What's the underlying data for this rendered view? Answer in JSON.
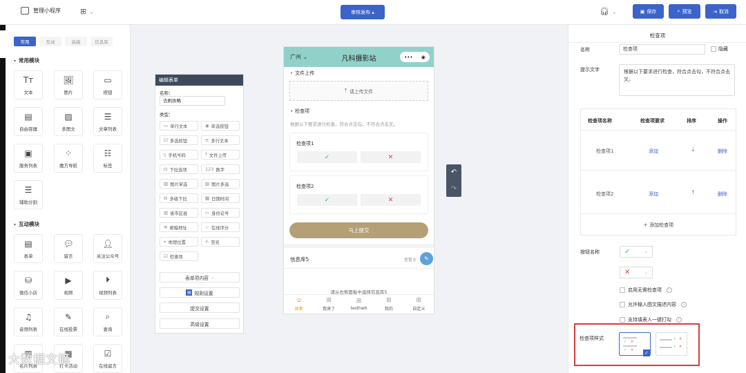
{
  "topbar": {
    "app_name": "管理小程序",
    "publish_label": "审核发布 ▴",
    "save_label": "保存",
    "preview_label": "预览",
    "cancel_label": "取消"
  },
  "left": {
    "tabs": [
      "常用",
      "互动",
      "高级",
      "信息库"
    ],
    "section_common": "常用模块",
    "section_interact": "互动模块",
    "common_items": [
      {
        "label": "文本",
        "icon": "text-icon"
      },
      {
        "label": "图片",
        "icon": "image-icon"
      },
      {
        "label": "按钮",
        "icon": "button-icon"
      },
      {
        "label": "自由容器",
        "icon": "container-icon"
      },
      {
        "label": "多图文",
        "icon": "multi-image-text-icon"
      },
      {
        "label": "文章列表",
        "icon": "article-list-icon"
      },
      {
        "label": "服务列表",
        "icon": "service-list-icon"
      },
      {
        "label": "魔方导航",
        "icon": "cube-nav-icon"
      },
      {
        "label": "标签",
        "icon": "tag-icon"
      },
      {
        "label": "辅助分割",
        "icon": "divider-icon"
      }
    ],
    "interact_items": [
      {
        "label": "表单",
        "icon": "form-icon"
      },
      {
        "label": "留言",
        "icon": "message-icon"
      },
      {
        "label": "关注公众号",
        "icon": "follow-icon"
      },
      {
        "label": "微信小店",
        "icon": "shop-icon"
      },
      {
        "label": "视频",
        "icon": "video-icon"
      },
      {
        "label": "视频列表",
        "icon": "video-list-icon"
      },
      {
        "label": "音频列表",
        "icon": "audio-list-icon"
      },
      {
        "label": "在线投票",
        "icon": "vote-icon"
      },
      {
        "label": "查询",
        "icon": "query-icon"
      },
      {
        "label": "名片列表",
        "icon": "card-list-icon"
      },
      {
        "label": "打卡活动",
        "icon": "checkin-icon"
      },
      {
        "label": "在线留言",
        "icon": "online-message-icon"
      }
    ],
    "watermark": "大数据文摘"
  },
  "form_editor": {
    "header": "编辑表单",
    "name_label": "名称：",
    "name_value": "去刷攻略",
    "type_label": "类型：",
    "types": [
      "单行文本",
      "单选按钮",
      "多选按钮",
      "多行文本",
      "手机号码",
      "文件上传",
      "下拉选项",
      "数字",
      "图片单选",
      "图片多选",
      "多级下拉",
      "日期时间",
      "省市区县",
      "身份证号",
      "邮箱地址",
      "在线评分",
      "地理位置",
      "签名",
      "检查项"
    ],
    "btn_content": "表单项内容",
    "btn_rules": "规则设置",
    "btn_submit": "提交设置",
    "btn_advanced": "高级设置"
  },
  "phone": {
    "city": "广州",
    "title": "凡科摄影站",
    "upload_section": "文件上传",
    "upload_button": "请上传文件",
    "check_section": "检查项",
    "check_desc": "根据以下要求进行检查，符合点击勾，不符合点击叉。",
    "check_items": [
      "检查项1",
      "检查项2"
    ],
    "submit": "马上提交",
    "info_title": "信息库5",
    "info_more": "查看全",
    "info_empty": "请从右侧面板中选择信息库5",
    "tabs": [
      "探索",
      "我来了",
      "testhwb",
      "我的",
      "自定义"
    ]
  },
  "right": {
    "title": "检查项",
    "name_label": "名称",
    "name_value": "检查项",
    "hide_label": "隐藏",
    "tip_label": "提示文字",
    "tip_value": "根据以下要求进行检查，符合点击勾，不符合点击叉。",
    "table_headers": [
      "检查项名称",
      "检查项要求",
      "排序",
      "操作"
    ],
    "rows": [
      {
        "name": "检查项1",
        "req": "添加",
        "sort": "↓",
        "op": "删除"
      },
      {
        "name": "检查项2",
        "req": "添加",
        "sort": "↑",
        "op": "删除"
      }
    ],
    "add_item": "＋ 添加检查项",
    "btn_name_label": "按钮名称",
    "option1": "启用无需检查项",
    "option2": "允许输入图文描述内容",
    "option3": "支持填表人一键打勾",
    "style_label": "检查项样式"
  },
  "colors": {
    "accent": "#3b63c9",
    "phone_header": "#92d1c9",
    "submit": "#b59f77",
    "highlight": "#d93a3a"
  }
}
